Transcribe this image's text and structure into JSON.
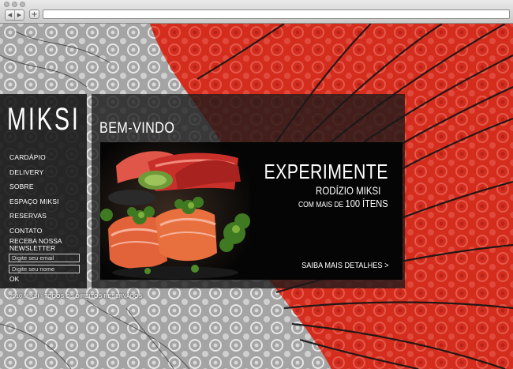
{
  "brand": {
    "logo": "MIKSI"
  },
  "nav": {
    "items": [
      "CARDÁPIO",
      "DELIVERY",
      "SOBRE",
      "ESPAÇO MIKSI",
      "RESERVAS",
      "CONTATO"
    ]
  },
  "newsletter": {
    "label": "RECEBA NOSSA NEWSLETTER",
    "email_placeholder": "Digite seu email",
    "name_placeholder": "Digite seu nome",
    "submit_label": "OK"
  },
  "main": {
    "title": "BEM-VINDO",
    "banner": {
      "headline": "EXPERIMENTE",
      "subheadline": "RODÍZIO MIKSI",
      "tagline_prefix": "COM MAIS DE",
      "tagline_count": "100 ÍTENS",
      "cta": "SAIBA MAIS DETALHES >"
    }
  },
  "footer": {
    "copyright": "2010 MIKSI - TODOS OS DIREITOS RESERVADOS"
  },
  "colors": {
    "red": "#d42d1e",
    "gray": "#9a9a9a",
    "panel": "#1a1a1a"
  }
}
